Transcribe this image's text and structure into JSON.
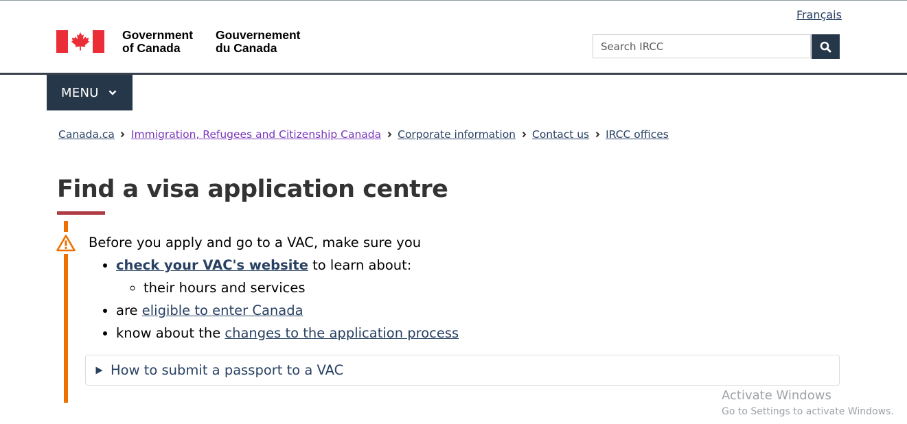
{
  "header": {
    "language_link": "Français",
    "wordmark_en_line1": "Government",
    "wordmark_en_line2": "of Canada",
    "wordmark_fr_line1": "Gouvernement",
    "wordmark_fr_line2": "du Canada",
    "search_placeholder": "Search IRCC",
    "menu_label": "MENU",
    "flag_colors": {
      "red": "#eb2d37",
      "white": "#ffffff"
    }
  },
  "breadcrumb": [
    {
      "label": "Canada.ca",
      "visited": false
    },
    {
      "label": "Immigration, Refugees and Citizenship Canada",
      "visited": true
    },
    {
      "label": "Corporate information",
      "visited": false
    },
    {
      "label": "Contact us",
      "visited": false
    },
    {
      "label": "IRCC offices",
      "visited": false
    }
  ],
  "page": {
    "title": "Find a visa application centre"
  },
  "alert": {
    "type": "warning",
    "accent_color": "#ee7100",
    "intro": "Before you apply and go to a VAC, make sure you",
    "item1_link": "check your VAC's website",
    "item1_text": " to learn about:",
    "item1_sub": "their hours and services",
    "item2_text": "are ",
    "item2_link": "eligible to enter Canada",
    "item3_text": "know about the ",
    "item3_link": "changes to the application process"
  },
  "details": {
    "summary": "How to submit a passport to a VAC"
  },
  "watermark": {
    "title": "Activate Windows",
    "subtitle": "Go to Settings to activate Windows."
  },
  "colors": {
    "link": "#284162",
    "visited_link": "#7834bc",
    "dark_blue": "#26374a",
    "title_underline": "#af3c43"
  }
}
